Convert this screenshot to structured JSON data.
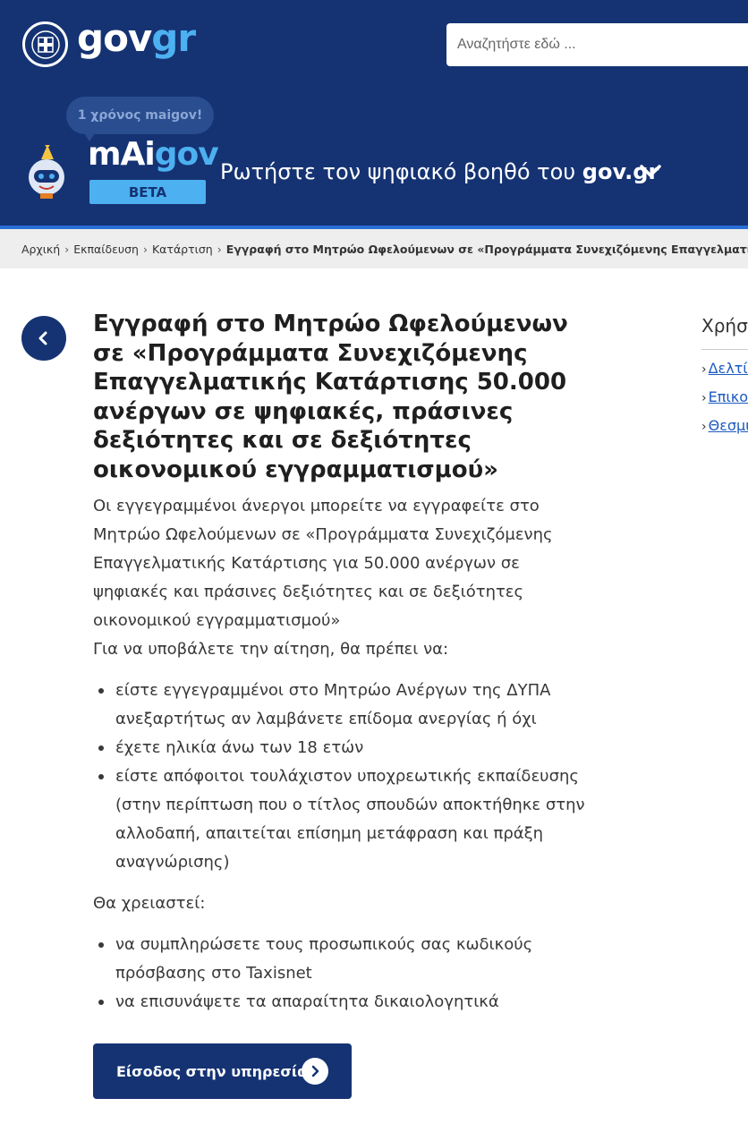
{
  "header": {
    "logo_gov": "gov",
    "logo_gr": "gr",
    "search_placeholder": "Αναζητήστε εδώ ...",
    "bubble_text": "1 χρόνος maigov!",
    "maigov_prefix": "mAi",
    "maigov_suffix": "gov",
    "beta_label": "BETA",
    "ask_prefix": "Ρωτήστε τον ψηφιακό βοηθό του ",
    "ask_bold": "gov.gr"
  },
  "breadcrumb": {
    "items": [
      "Αρχική",
      "Εκπαίδευση",
      "Κατάρτιση"
    ],
    "current": "Εγγραφή στο Μητρώο Ωφελούμενων σε «Προγράμματα Συνεχιζόμενης Επαγγελματικής Κατάρτισης"
  },
  "main": {
    "title": "Εγγραφή στο Μητρώο Ωφελούμενων σε «Προγράμματα Συνεχιζόμενης Επαγγελματικής Κατάρτισης 50.000 ανέργων σε ψηφιακές, πράσινες δεξιότητες και σε δεξιότητες οικονομικού εγγραμματισμού»",
    "intro": "Οι εγγεγραμμένοι άνεργοι μπορείτε να εγγραφείτε στο Μητρώο Ωφελούμενων σε «Προγράμματα Συνεχιζόμενης Επαγγελματικής Κατάρτισης για 50.000 ανέργων σε ψηφιακές και πράσινες δεξιότητες και σε δεξιότητες οικονομικού εγγραμματισμού»",
    "requirements_lead": "Για να υποβάλετε την αίτηση, θα πρέπει να:",
    "requirements": [
      "είστε εγγεγραμμένοι στο Μητρώο Ανέργων της ΔΥΠΑ ανεξαρτήτως αν λαμβάνετε επίδομα ανεργίας ή όχι",
      "έχετε ηλικία άνω των 18 ετών",
      "είστε απόφοιτοι τουλάχιστον υποχρεωτικής εκπαίδευσης (στην περίπτωση που ο τίτλος σπουδών αποκτήθηκε στην αλλοδαπή, απαιτείται επίσημη μετάφραση και πράξη αναγνώρισης)"
    ],
    "needs_lead": "Θα χρειαστεί:",
    "needs": [
      "να συμπληρώσετε τους προσωπικούς σας κωδικούς πρόσβασης στο Taxisnet",
      "να επισυνάψετε τα απαραίτητα δικαιολογητικά"
    ],
    "cta_label": "Είσοδος στην υπηρεσία"
  },
  "sidebar": {
    "title": "Χρήσι",
    "links": [
      "Δελτίο",
      "Επικο",
      "Θεσμι"
    ]
  },
  "colors": {
    "header_bg": "#153373",
    "accent_light_blue": "#4db0f0",
    "link": "#1d5bbf"
  }
}
